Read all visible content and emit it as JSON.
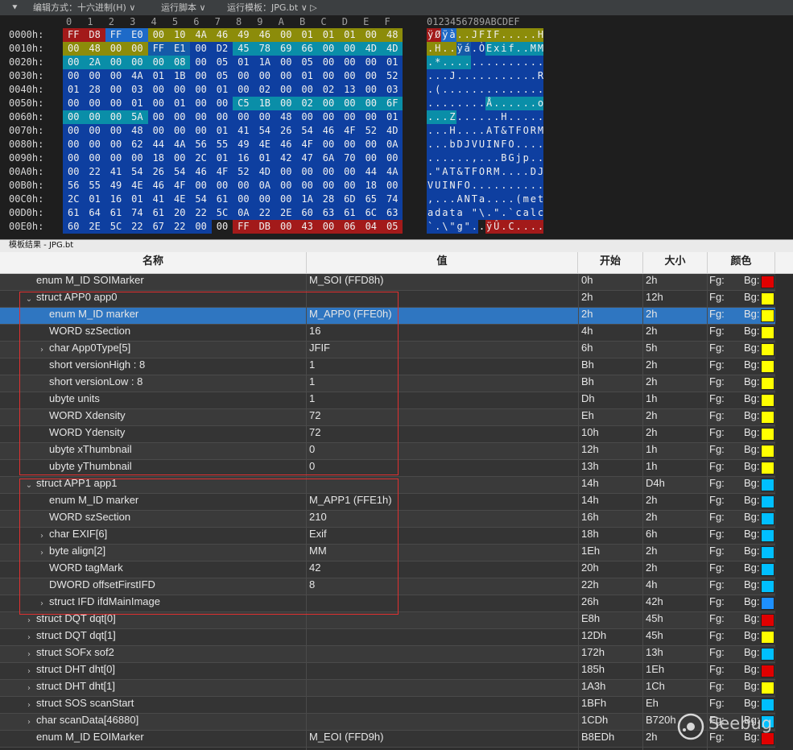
{
  "toolbar": {
    "edit_mode": "编辑方式：十六进制(H) ∨",
    "run_script": "运行脚本 ∨",
    "run_template": "运行模板：JPG.bt ∨ ▷"
  },
  "hex": {
    "column_header": "0 1 2 3 4 5 6 7 8 9 A B C D E F",
    "ascii_header": "0123456789ABCDEF",
    "rows": [
      {
        "addr": "0000h:",
        "bytes": [
          "FF",
          "D8",
          "FF",
          "E0",
          "00",
          "10",
          "4A",
          "46",
          "49",
          "46",
          "00",
          "01",
          "01",
          "01",
          "00",
          "48"
        ],
        "ascii": "ÿØÿà..JFIF.....H",
        "colors": [
          "#a31a1a",
          "#a31a1a",
          "#1e6ac8",
          "#1e6ac8",
          "#8c8c0a",
          "#8c8c0a",
          "#8c8c0a",
          "#8c8c0a",
          "#8c8c0a",
          "#8c8c0a",
          "#8c8c0a",
          "#8c8c0a",
          "#8c8c0a",
          "#8c8c0a",
          "#8c8c0a",
          "#8c8c0a"
        ]
      },
      {
        "addr": "0010h:",
        "bytes": [
          "00",
          "48",
          "00",
          "00",
          "FF",
          "E1",
          "00",
          "D2",
          "45",
          "78",
          "69",
          "66",
          "00",
          "00",
          "4D",
          "4D"
        ],
        "ascii": ".H..ÿá.ÒExif..MM",
        "colors": [
          "#8c8c0a",
          "#8c8c0a",
          "#8c8c0a",
          "#8c8c0a",
          "#155aa8",
          "#155aa8",
          "#0e3fa0",
          "#0e3fa0",
          "#0a8ea8",
          "#0a8ea8",
          "#0a8ea8",
          "#0a8ea8",
          "#0a8ea8",
          "#0a8ea8",
          "#0a8ea8",
          "#0a8ea8"
        ]
      },
      {
        "addr": "0020h:",
        "bytes": [
          "00",
          "2A",
          "00",
          "00",
          "00",
          "08",
          "00",
          "05",
          "01",
          "1A",
          "00",
          "05",
          "00",
          "00",
          "00",
          "01"
        ],
        "ascii": ".*..............",
        "colors": [
          "#0a8ea8",
          "#0a8ea8",
          "#0a8ea8",
          "#0a8ea8",
          "#0a8ea8",
          "#0a8ea8",
          "#0e3fa0",
          "#0e3fa0",
          "#0e3fa0",
          "#0e3fa0",
          "#0e3fa0",
          "#0e3fa0",
          "#0e3fa0",
          "#0e3fa0",
          "#0e3fa0",
          "#0e3fa0"
        ]
      },
      {
        "addr": "0030h:",
        "bytes": [
          "00",
          "00",
          "00",
          "4A",
          "01",
          "1B",
          "00",
          "05",
          "00",
          "00",
          "00",
          "01",
          "00",
          "00",
          "00",
          "52"
        ],
        "ascii": "...J...........R",
        "colors": [
          "#0e3fa0",
          "#0e3fa0",
          "#0e3fa0",
          "#0e3fa0",
          "#0e3fa0",
          "#0e3fa0",
          "#0e3fa0",
          "#0e3fa0",
          "#0e3fa0",
          "#0e3fa0",
          "#0e3fa0",
          "#0e3fa0",
          "#0e3fa0",
          "#0e3fa0",
          "#0e3fa0",
          "#0e3fa0"
        ]
      },
      {
        "addr": "0040h:",
        "bytes": [
          "01",
          "28",
          "00",
          "03",
          "00",
          "00",
          "00",
          "01",
          "00",
          "02",
          "00",
          "00",
          "02",
          "13",
          "00",
          "03"
        ],
        "ascii": ".(..............",
        "colors": [
          "#0e3fa0",
          "#0e3fa0",
          "#0e3fa0",
          "#0e3fa0",
          "#0e3fa0",
          "#0e3fa0",
          "#0e3fa0",
          "#0e3fa0",
          "#0e3fa0",
          "#0e3fa0",
          "#0e3fa0",
          "#0e3fa0",
          "#0e3fa0",
          "#0e3fa0",
          "#0e3fa0",
          "#0e3fa0"
        ]
      },
      {
        "addr": "0050h:",
        "bytes": [
          "00",
          "00",
          "00",
          "01",
          "00",
          "01",
          "00",
          "00",
          "C5",
          "1B",
          "00",
          "02",
          "00",
          "00",
          "00",
          "6F"
        ],
        "ascii": "........Å......o",
        "colors": [
          "#0e3fa0",
          "#0e3fa0",
          "#0e3fa0",
          "#0e3fa0",
          "#0e3fa0",
          "#0e3fa0",
          "#0e3fa0",
          "#0e3fa0",
          "#0a8ea8",
          "#0a8ea8",
          "#0a8ea8",
          "#0a8ea8",
          "#0a8ea8",
          "#0a8ea8",
          "#0a8ea8",
          "#0a8ea8"
        ]
      },
      {
        "addr": "0060h:",
        "bytes": [
          "00",
          "00",
          "00",
          "5A",
          "00",
          "00",
          "00",
          "00",
          "00",
          "00",
          "48",
          "00",
          "00",
          "00",
          "00",
          "01"
        ],
        "ascii": "...Z......H.....",
        "colors": [
          "#0a8ea8",
          "#0a8ea8",
          "#0a8ea8",
          "#0a8ea8",
          "#0e3fa0",
          "#0e3fa0",
          "#0e3fa0",
          "#0e3fa0",
          "#0e3fa0",
          "#0e3fa0",
          "#0e3fa0",
          "#0e3fa0",
          "#0e3fa0",
          "#0e3fa0",
          "#0e3fa0",
          "#0e3fa0"
        ]
      },
      {
        "addr": "0070h:",
        "bytes": [
          "00",
          "00",
          "00",
          "48",
          "00",
          "00",
          "00",
          "01",
          "41",
          "54",
          "26",
          "54",
          "46",
          "4F",
          "52",
          "4D"
        ],
        "ascii": "...H....AT&TFORM",
        "colors": [
          "#0e3fa0",
          "#0e3fa0",
          "#0e3fa0",
          "#0e3fa0",
          "#0e3fa0",
          "#0e3fa0",
          "#0e3fa0",
          "#0e3fa0",
          "#0e3fa0",
          "#0e3fa0",
          "#0e3fa0",
          "#0e3fa0",
          "#0e3fa0",
          "#0e3fa0",
          "#0e3fa0",
          "#0e3fa0"
        ]
      },
      {
        "addr": "0080h:",
        "bytes": [
          "00",
          "00",
          "00",
          "62",
          "44",
          "4A",
          "56",
          "55",
          "49",
          "4E",
          "46",
          "4F",
          "00",
          "00",
          "00",
          "0A"
        ],
        "ascii": "...bDJVUINFO....",
        "colors": [
          "#0e3fa0",
          "#0e3fa0",
          "#0e3fa0",
          "#0e3fa0",
          "#0e3fa0",
          "#0e3fa0",
          "#0e3fa0",
          "#0e3fa0",
          "#0e3fa0",
          "#0e3fa0",
          "#0e3fa0",
          "#0e3fa0",
          "#0e3fa0",
          "#0e3fa0",
          "#0e3fa0",
          "#0e3fa0"
        ]
      },
      {
        "addr": "0090h:",
        "bytes": [
          "00",
          "00",
          "00",
          "00",
          "18",
          "00",
          "2C",
          "01",
          "16",
          "01",
          "42",
          "47",
          "6A",
          "70",
          "00",
          "00"
        ],
        "ascii": "......,...BGjp..",
        "colors": [
          "#0e3fa0",
          "#0e3fa0",
          "#0e3fa0",
          "#0e3fa0",
          "#0e3fa0",
          "#0e3fa0",
          "#0e3fa0",
          "#0e3fa0",
          "#0e3fa0",
          "#0e3fa0",
          "#0e3fa0",
          "#0e3fa0",
          "#0e3fa0",
          "#0e3fa0",
          "#0e3fa0",
          "#0e3fa0"
        ]
      },
      {
        "addr": "00A0h:",
        "bytes": [
          "00",
          "22",
          "41",
          "54",
          "26",
          "54",
          "46",
          "4F",
          "52",
          "4D",
          "00",
          "00",
          "00",
          "00",
          "44",
          "4A"
        ],
        "ascii": ".\"AT&TFORM....DJ",
        "colors": [
          "#0e3fa0",
          "#0e3fa0",
          "#0e3fa0",
          "#0e3fa0",
          "#0e3fa0",
          "#0e3fa0",
          "#0e3fa0",
          "#0e3fa0",
          "#0e3fa0",
          "#0e3fa0",
          "#0e3fa0",
          "#0e3fa0",
          "#0e3fa0",
          "#0e3fa0",
          "#0e3fa0",
          "#0e3fa0"
        ]
      },
      {
        "addr": "00B0h:",
        "bytes": [
          "56",
          "55",
          "49",
          "4E",
          "46",
          "4F",
          "00",
          "00",
          "00",
          "0A",
          "00",
          "00",
          "00",
          "00",
          "18",
          "00"
        ],
        "ascii": "VUINFO..........",
        "colors": [
          "#0e3fa0",
          "#0e3fa0",
          "#0e3fa0",
          "#0e3fa0",
          "#0e3fa0",
          "#0e3fa0",
          "#0e3fa0",
          "#0e3fa0",
          "#0e3fa0",
          "#0e3fa0",
          "#0e3fa0",
          "#0e3fa0",
          "#0e3fa0",
          "#0e3fa0",
          "#0e3fa0",
          "#0e3fa0"
        ]
      },
      {
        "addr": "00C0h:",
        "bytes": [
          "2C",
          "01",
          "16",
          "01",
          "41",
          "4E",
          "54",
          "61",
          "00",
          "00",
          "00",
          "1A",
          "28",
          "6D",
          "65",
          "74"
        ],
        "ascii": ",...ANTa....(met",
        "colors": [
          "#0e3fa0",
          "#0e3fa0",
          "#0e3fa0",
          "#0e3fa0",
          "#0e3fa0",
          "#0e3fa0",
          "#0e3fa0",
          "#0e3fa0",
          "#0e3fa0",
          "#0e3fa0",
          "#0e3fa0",
          "#0e3fa0",
          "#0e3fa0",
          "#0e3fa0",
          "#0e3fa0",
          "#0e3fa0"
        ]
      },
      {
        "addr": "00D0h:",
        "bytes": [
          "61",
          "64",
          "61",
          "74",
          "61",
          "20",
          "22",
          "5C",
          "0A",
          "22",
          "2E",
          "60",
          "63",
          "61",
          "6C",
          "63"
        ],
        "ascii": "adata \"\\.\".`calc",
        "colors": [
          "#0e3fa0",
          "#0e3fa0",
          "#0e3fa0",
          "#0e3fa0",
          "#0e3fa0",
          "#0e3fa0",
          "#0e3fa0",
          "#0e3fa0",
          "#0e3fa0",
          "#0e3fa0",
          "#0e3fa0",
          "#0e3fa0",
          "#0e3fa0",
          "#0e3fa0",
          "#0e3fa0",
          "#0e3fa0"
        ]
      },
      {
        "addr": "00E0h:",
        "bytes": [
          "60",
          "2E",
          "5C",
          "22",
          "67",
          "22",
          "00",
          "00",
          "FF",
          "DB",
          "00",
          "43",
          "00",
          "06",
          "04",
          "05"
        ],
        "ascii": "`.\\\"g\"..ÿÛ.C....",
        "colors": [
          "#0e3fa0",
          "#0e3fa0",
          "#0e3fa0",
          "#0e3fa0",
          "#0e3fa0",
          "#0e3fa0",
          "#0e3fa0",
          "#1e1e1e",
          "#a31a1a",
          "#a31a1a",
          "#a31a1a",
          "#a31a1a",
          "#a31a1a",
          "#a31a1a",
          "#a31a1a",
          "#a31a1a"
        ]
      }
    ]
  },
  "template_bar": "模板结果 - JPG.bt",
  "columns": {
    "name": "名称",
    "value": "值",
    "start": "开始",
    "size": "大小",
    "color": "颜色"
  },
  "color_labels": {
    "fg": "Fg:",
    "bg": "Bg:"
  },
  "rows": [
    {
      "indent": 0,
      "toggle": "",
      "name": "enum M_ID SOIMarker",
      "value": "M_SOI (FFD8h)",
      "start": "0h",
      "size": "2h",
      "swatch": "#e00000"
    },
    {
      "indent": 0,
      "toggle": "⌄",
      "name": "struct APP0 app0",
      "value": "",
      "start": "2h",
      "size": "12h",
      "swatch": "#ffff00"
    },
    {
      "indent": 1,
      "toggle": "",
      "name": "enum M_ID marker",
      "value": "M_APP0 (FFE0h)",
      "start": "2h",
      "size": "2h",
      "swatch": "#ffff00",
      "selected": true
    },
    {
      "indent": 1,
      "toggle": "",
      "name": "WORD szSection",
      "value": "16",
      "start": "4h",
      "size": "2h",
      "swatch": "#ffff00"
    },
    {
      "indent": 1,
      "toggle": "›",
      "name": "char App0Type[5]",
      "value": "JFIF",
      "start": "6h",
      "size": "5h",
      "swatch": "#ffff00"
    },
    {
      "indent": 1,
      "toggle": "",
      "name": "short versionHigh : 8",
      "value": "1",
      "start": "Bh",
      "size": "2h",
      "swatch": "#ffff00"
    },
    {
      "indent": 1,
      "toggle": "",
      "name": "short versionLow : 8",
      "value": "1",
      "start": "Bh",
      "size": "2h",
      "swatch": "#ffff00"
    },
    {
      "indent": 1,
      "toggle": "",
      "name": "ubyte units",
      "value": "1",
      "start": "Dh",
      "size": "1h",
      "swatch": "#ffff00"
    },
    {
      "indent": 1,
      "toggle": "",
      "name": "WORD Xdensity",
      "value": "72",
      "start": "Eh",
      "size": "2h",
      "swatch": "#ffff00"
    },
    {
      "indent": 1,
      "toggle": "",
      "name": "WORD Ydensity",
      "value": "72",
      "start": "10h",
      "size": "2h",
      "swatch": "#ffff00"
    },
    {
      "indent": 1,
      "toggle": "",
      "name": "ubyte xThumbnail",
      "value": "0",
      "start": "12h",
      "size": "1h",
      "swatch": "#ffff00"
    },
    {
      "indent": 1,
      "toggle": "",
      "name": "ubyte yThumbnail",
      "value": "0",
      "start": "13h",
      "size": "1h",
      "swatch": "#ffff00"
    },
    {
      "indent": 0,
      "toggle": "⌄",
      "name": "struct APP1 app1",
      "value": "",
      "start": "14h",
      "size": "D4h",
      "swatch": "#00bfff"
    },
    {
      "indent": 1,
      "toggle": "",
      "name": "enum M_ID marker",
      "value": "M_APP1 (FFE1h)",
      "start": "14h",
      "size": "2h",
      "swatch": "#00bfff"
    },
    {
      "indent": 1,
      "toggle": "",
      "name": "WORD szSection",
      "value": "210",
      "start": "16h",
      "size": "2h",
      "swatch": "#00bfff"
    },
    {
      "indent": 1,
      "toggle": "›",
      "name": "char EXIF[6]",
      "value": "Exif",
      "start": "18h",
      "size": "6h",
      "swatch": "#00bfff"
    },
    {
      "indent": 1,
      "toggle": "›",
      "name": "byte align[2]",
      "value": "MM",
      "start": "1Eh",
      "size": "2h",
      "swatch": "#00bfff"
    },
    {
      "indent": 1,
      "toggle": "",
      "name": "WORD tagMark",
      "value": "42",
      "start": "20h",
      "size": "2h",
      "swatch": "#00bfff"
    },
    {
      "indent": 1,
      "toggle": "",
      "name": "DWORD offsetFirstIFD",
      "value": "8",
      "start": "22h",
      "size": "4h",
      "swatch": "#00bfff"
    },
    {
      "indent": 1,
      "toggle": "›",
      "name": "struct IFD ifdMainImage",
      "value": "",
      "start": "26h",
      "size": "42h",
      "swatch": "#1e90ff"
    },
    {
      "indent": 0,
      "toggle": "›",
      "name": "struct DQT dqt[0]",
      "value": "",
      "start": "E8h",
      "size": "45h",
      "swatch": "#e00000"
    },
    {
      "indent": 0,
      "toggle": "›",
      "name": "struct DQT dqt[1]",
      "value": "",
      "start": "12Dh",
      "size": "45h",
      "swatch": "#ffff00"
    },
    {
      "indent": 0,
      "toggle": "›",
      "name": "struct SOFx sof2",
      "value": "",
      "start": "172h",
      "size": "13h",
      "swatch": "#00bfff"
    },
    {
      "indent": 0,
      "toggle": "›",
      "name": "struct DHT dht[0]",
      "value": "",
      "start": "185h",
      "size": "1Eh",
      "swatch": "#e00000"
    },
    {
      "indent": 0,
      "toggle": "›",
      "name": "struct DHT dht[1]",
      "value": "",
      "start": "1A3h",
      "size": "1Ch",
      "swatch": "#ffff00"
    },
    {
      "indent": 0,
      "toggle": "›",
      "name": "struct SOS scanStart",
      "value": "",
      "start": "1BFh",
      "size": "Eh",
      "swatch": "#00bfff"
    },
    {
      "indent": 0,
      "toggle": "›",
      "name": "char scanData[46880]",
      "value": "",
      "start": "1CDh",
      "size": "B720h",
      "swatch": "#00bfff"
    },
    {
      "indent": 0,
      "toggle": "",
      "name": "enum M_ID EOIMarker",
      "value": "M_EOI (FFD9h)",
      "start": "B8EDh",
      "size": "2h",
      "swatch": "#e00000"
    }
  ],
  "watermark": "Seebug"
}
